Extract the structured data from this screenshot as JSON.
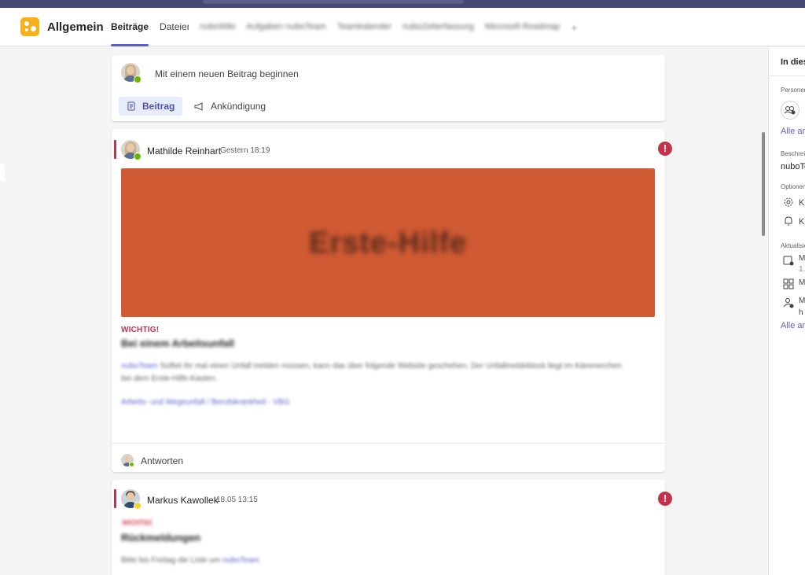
{
  "header": {
    "channel_title": "Allgemein",
    "tabs": [
      {
        "label": "Beiträge",
        "active": true,
        "blurred": false
      },
      {
        "label": "Dateien",
        "active": false,
        "blurred": false
      },
      {
        "label": "nuboWiki",
        "active": false,
        "blurred": true
      },
      {
        "label": "Aufgaben nuboTeam",
        "active": false,
        "blurred": true
      },
      {
        "label": "Teamkalender",
        "active": false,
        "blurred": true
      },
      {
        "label": "nuboZeiterfassung",
        "active": false,
        "blurred": true
      },
      {
        "label": "Microsoft Roadmap",
        "active": false,
        "blurred": true
      }
    ],
    "add_tab_icon": "+"
  },
  "compose": {
    "prompt": "Mit einem neuen Beitrag beginnen",
    "post_button": "Beitrag",
    "announcement_button": "Ankündigung"
  },
  "posts": [
    {
      "author": "Mathilde Reinhart",
      "timestamp": "Gestern 18:19",
      "banner_text": "Erste-Hilfe",
      "important_label": "WICHTIG!",
      "subject": "Bei einem Arbeitsunfall",
      "body_mention": "nuboTeam",
      "body": "Solltet ihr mal einen Unfall melden müssen, kann das über folgende Website geschehen. Der Unfallmeldeblock liegt im Kämmerchen bei dem Erste-Hilfe-Kasten.",
      "link": "Arbeits- und Wegeunfall / Berufskrankheit - VBG",
      "reply_label": "Antworten"
    },
    {
      "author": "Markus Kawollek",
      "timestamp": "18.05 13:15",
      "important_label": "WICHTIG!",
      "subject": "Rückmeldungen",
      "body": "Bitte bis Freitag die Liste um",
      "body_mention": "nuboTeam"
    }
  ],
  "right_pane": {
    "title": "In diesem Kanal",
    "people_label": "Personen",
    "all_link_1": "Alle anzeigen",
    "description_label": "Beschreibung",
    "description_text": "nuboTeam",
    "options_label": "Optionen",
    "option_1": "Kanaleinstellungen",
    "option_2": "Kanalbenachrichtigungen",
    "updates_label": "Aktualisierungen",
    "update_1a": "M",
    "update_1b": "1.",
    "update_2": "M",
    "update_3a": "M",
    "update_3b": "h",
    "all_link_2": "Alle anzeigen"
  },
  "colors": {
    "accent": "#5b5fc7",
    "top_bar": "#464775",
    "important": "#c4314b",
    "banner": "#cf5a33",
    "team_icon": "#f7b21b"
  }
}
